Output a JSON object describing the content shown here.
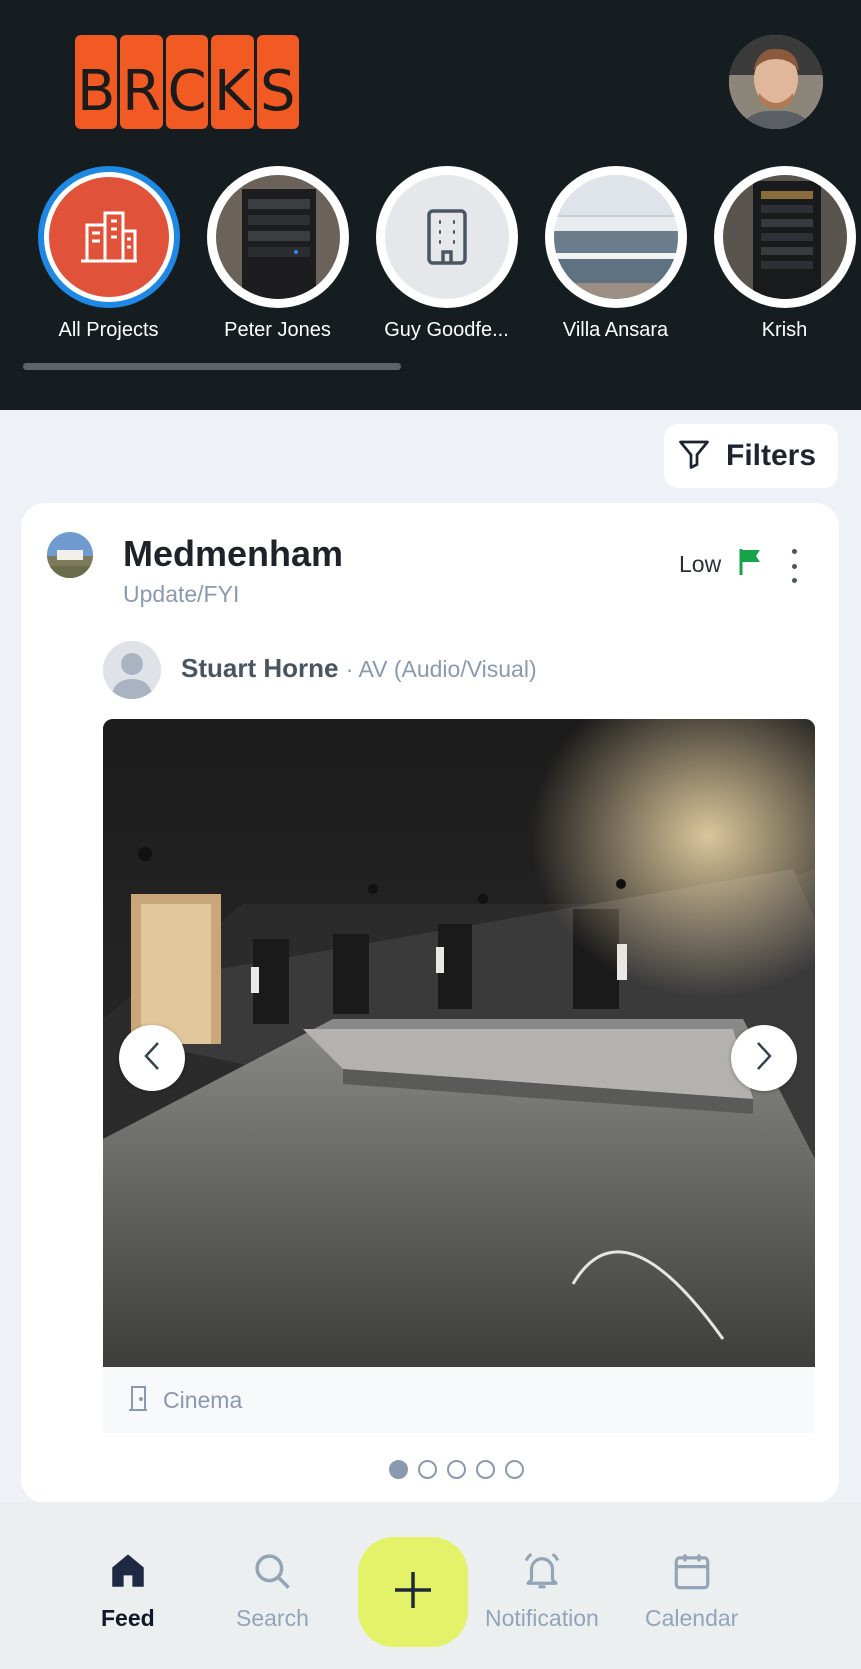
{
  "header": {
    "logo_letters": [
      "B",
      "R",
      "C",
      "K",
      "S"
    ],
    "brand_color": "#f15a22",
    "profile_avatar": "user-avatar"
  },
  "projects": [
    {
      "label": "All Projects",
      "icon": "buildings-icon",
      "active": true
    },
    {
      "label": "Peter Jones",
      "icon": "server-rack-photo"
    },
    {
      "label": "Guy Goodfe...",
      "icon": "building-icon"
    },
    {
      "label": "Villa Ansara",
      "icon": "villa-photo"
    },
    {
      "label": "Krish",
      "icon": "server-rack-photo"
    }
  ],
  "filters": {
    "label": "Filters",
    "icon": "funnel-icon"
  },
  "post": {
    "project": "Medmenham",
    "type": "Update/FYI",
    "priority": "Low",
    "priority_color": "#16a34a",
    "author": "Stuart Horne",
    "role": "· AV (Audio/Visual)",
    "location": "Cinema",
    "image_count": 5,
    "image_index": 1
  },
  "nav": {
    "feed": "Feed",
    "search": "Search",
    "notification": "Notification",
    "calendar": "Calendar",
    "fab_color": "#e4f26a"
  }
}
